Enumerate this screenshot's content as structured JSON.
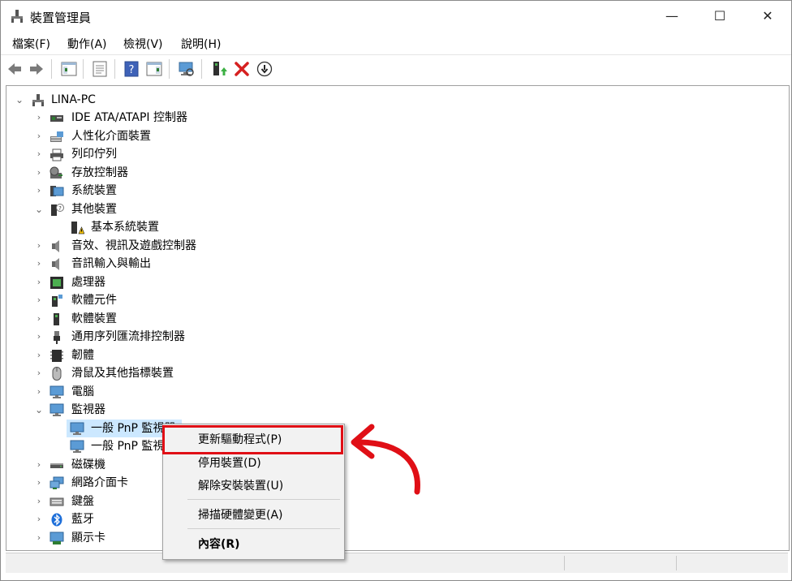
{
  "window": {
    "title": "裝置管理員",
    "minimize": "—",
    "maximize": "☐",
    "close": "✕"
  },
  "menu": [
    "檔案(F)",
    "動作(A)",
    "檢視(V)",
    "說明(H)"
  ],
  "tree": {
    "root": "LINA-PC",
    "items": [
      {
        "label": "IDE ATA/ATAPI 控制器",
        "state": "collapsed"
      },
      {
        "label": "人性化介面裝置",
        "state": "collapsed"
      },
      {
        "label": "列印佇列",
        "state": "collapsed"
      },
      {
        "label": "存放控制器",
        "state": "collapsed"
      },
      {
        "label": "系統裝置",
        "state": "collapsed"
      },
      {
        "label": "其他裝置",
        "state": "expanded"
      },
      {
        "label": "基本系統裝置",
        "state": "child"
      },
      {
        "label": "音效、視訊及遊戲控制器",
        "state": "collapsed"
      },
      {
        "label": "音訊輸入與輸出",
        "state": "collapsed"
      },
      {
        "label": "處理器",
        "state": "collapsed"
      },
      {
        "label": "軟體元件",
        "state": "collapsed"
      },
      {
        "label": "軟體裝置",
        "state": "collapsed"
      },
      {
        "label": "通用序列匯流排控制器",
        "state": "collapsed"
      },
      {
        "label": "韌體",
        "state": "collapsed"
      },
      {
        "label": "滑鼠及其他指標裝置",
        "state": "collapsed"
      },
      {
        "label": "電腦",
        "state": "collapsed"
      },
      {
        "label": "監視器",
        "state": "expanded"
      },
      {
        "label": "一般 PnP 監視器",
        "state": "child-selected"
      },
      {
        "label": "一般 PnP 監視",
        "state": "child"
      },
      {
        "label": "磁碟機",
        "state": "collapsed"
      },
      {
        "label": "網路介面卡",
        "state": "collapsed"
      },
      {
        "label": "鍵盤",
        "state": "collapsed"
      },
      {
        "label": "藍牙",
        "state": "collapsed"
      },
      {
        "label": "顯示卡",
        "state": "collapsed"
      }
    ]
  },
  "context_menu": {
    "update_driver": "更新驅動程式(P)",
    "disable": "停用裝置(D)",
    "uninstall": "解除安裝裝置(U)",
    "scan": "掃描硬體變更(A)",
    "properties": "內容(R)"
  },
  "colors": {
    "highlight": "#e00f16",
    "selection": "#cce8ff"
  }
}
